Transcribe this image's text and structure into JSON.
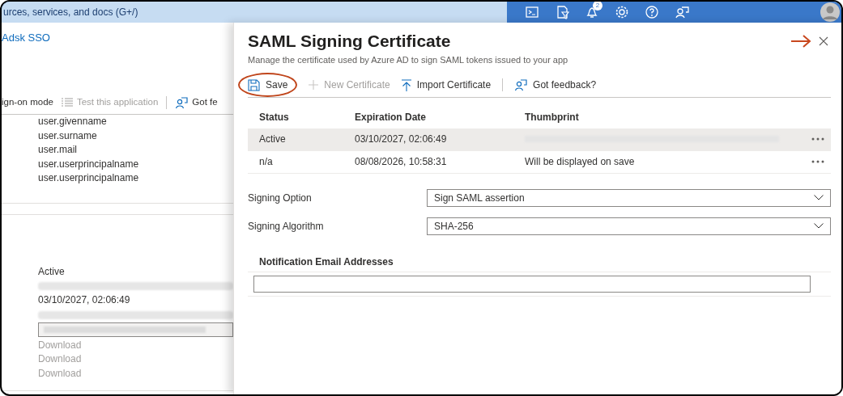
{
  "top_bar": {
    "search": {
      "placeholder": "urces, services, and docs (G+/)"
    },
    "notification_count": "2"
  },
  "background_page": {
    "app_title": "Adsk SSO",
    "toolbar": [
      {
        "kind": "text",
        "label": "ign-on mode",
        "disabled": false
      },
      {
        "kind": "test",
        "label": "Test this application",
        "disabled": true
      },
      {
        "kind": "feedback",
        "label": "Got fe",
        "disabled": false
      }
    ],
    "attribute_values": [
      "user.givenname",
      "user.surname",
      "user.mail",
      "user.userprincipalname",
      "user.userprincipalname"
    ],
    "certificate_status": "Active",
    "certificate_expiration": "03/10/2027, 02:06:49",
    "download_links": [
      "Download",
      "Download",
      "Download"
    ]
  },
  "blade": {
    "title": "SAML Signing Certificate",
    "subtitle": "Manage the certificate used by Azure AD to sign SAML tokens issued to your app",
    "toolbar": [
      {
        "kind": "save",
        "label": "Save",
        "disabled": false,
        "highlighted": true
      },
      {
        "kind": "new",
        "label": "New Certificate",
        "disabled": true,
        "highlighted": false
      },
      {
        "kind": "import",
        "label": "Import Certificate",
        "disabled": false,
        "highlighted": false
      },
      {
        "kind": "feedback",
        "label": "Got feedback?",
        "disabled": false,
        "highlighted": false
      }
    ],
    "table": {
      "columns": [
        "Status",
        "Expiration Date",
        "Thumbprint"
      ],
      "rows": [
        {
          "status": "Active",
          "expiration": "03/10/2027, 02:06:49",
          "thumbprint_hidden": true,
          "selected": true
        },
        {
          "status": "n/a",
          "expiration": "08/08/2026, 10:58:31",
          "thumbprint": "Will be displayed on save",
          "selected": false
        }
      ]
    },
    "fields": [
      {
        "label": "Signing Option",
        "value": "Sign SAML assertion"
      },
      {
        "label": "Signing Algorithm",
        "value": "SHA-256"
      }
    ],
    "notification_header": "Notification Email Addresses"
  }
}
